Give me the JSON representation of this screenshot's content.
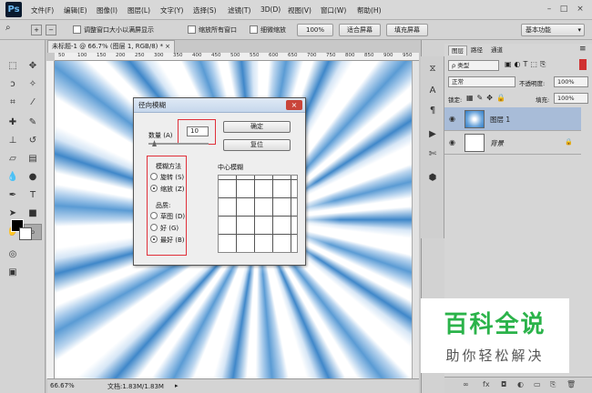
{
  "menubar": {
    "logo": "Ps",
    "items": [
      "文件(F)",
      "编辑(E)",
      "图像(I)",
      "图层(L)",
      "文字(Y)",
      "选择(S)",
      "滤镜(T)",
      "3D(D)",
      "视图(V)",
      "窗口(W)",
      "帮助(H)"
    ],
    "minimize": "–",
    "maximize": "□",
    "close": "×"
  },
  "optbar": {
    "resize_windows": "调整窗口大小以满屏显示",
    "zoom_all": "缩放所有窗口",
    "scrubby_zoom": "细微缩放",
    "btn_100": "100%",
    "btn_fit": "适合屏幕",
    "btn_fill": "填充屏幕",
    "workspace": "基本功能"
  },
  "document": {
    "tab": "未标题-1 @ 66.7% (图层 1, RGB/8) *",
    "ruler_ticks": [
      "50",
      "100",
      "150",
      "200",
      "250",
      "300",
      "350",
      "400",
      "450",
      "500",
      "550",
      "600",
      "650",
      "700",
      "750",
      "800",
      "850",
      "900",
      "950"
    ],
    "zoom": "66.67%",
    "doc_info": "文档:1.83M/1.83M"
  },
  "dialog": {
    "title": "径向模糊",
    "close": "×",
    "amount_label": "数量 (A)",
    "amount_value": "10",
    "ok": "确定",
    "reset": "复位",
    "method_label": "模糊方法",
    "spin": "旋转 (S)",
    "zoom": "缩放 (Z)",
    "quality_label": "品质:",
    "draft": "草图 (D)",
    "good": "好 (G)",
    "best": "最好 (B)",
    "center_label": "中心模糊"
  },
  "layers_panel": {
    "tabs": [
      "图层",
      "路径",
      "通道"
    ],
    "kind": "ρ 类型",
    "blend_mode": "正常",
    "opacity_label": "不透明度:",
    "opacity": "100%",
    "lock_label": "锁定:",
    "fill_label": "填充:",
    "fill": "100%",
    "layers": [
      {
        "name": "图层 1"
      },
      {
        "name": "背景"
      }
    ]
  },
  "watermark": {
    "title": "百科全说",
    "subtitle": "助你轻松解决"
  }
}
